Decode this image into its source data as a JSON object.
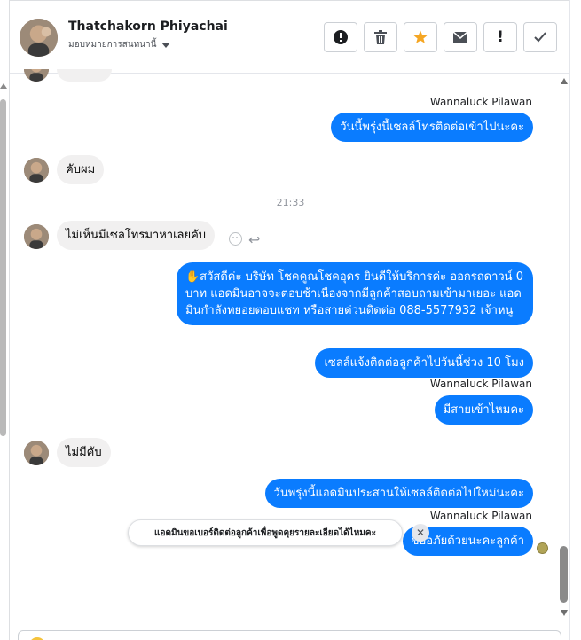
{
  "header": {
    "contact_name": "Thatchakorn Phiyachai",
    "contact_status": "มอบหมายการสนทนานี้",
    "actions": [
      {
        "name": "report-button",
        "glyph": "!",
        "icon": "alert-circle-icon"
      },
      {
        "name": "delete-button",
        "glyph": "🗑",
        "icon": "trash-icon"
      },
      {
        "name": "star-button",
        "glyph": "★",
        "icon": "star-icon"
      },
      {
        "name": "mark-unread-button",
        "glyph": "✉",
        "icon": "envelope-icon"
      },
      {
        "name": "spam-button",
        "glyph": "!",
        "icon": "exclamation-icon"
      },
      {
        "name": "done-button",
        "glyph": "✓",
        "icon": "check-icon"
      }
    ]
  },
  "messages": {
    "sender_1": "Wannaluck Pilawan",
    "out_1": "วันนี้พรุ่งนี้เซลล์โทรติดต่อเข้าไปนะคะ",
    "in_1": "คับผม",
    "time_1": "21:33",
    "in_2": "ไม่เห็นมีเซลโทรมาหาเลยคับ",
    "out_2": "✋สวัสดีค่ะ บริษัท โชคคูณโชคอุดร ยินดีให้บริการค่ะ ออกรถดาวน์ 0 บาท แอดมินอาจจะตอบช้าเนื่องจากมีลูกค้าสอบถามเข้ามาเยอะ แอดมินกำลังทยอยตอบแชท หรือสายด่วนติดต่อ 088-5577932 เจ้าหนู",
    "out_3": "เซลล์แจ้งติดต่อลูกค้าไปวันนี้ช่วง 10 โมง",
    "sender_2": "Wannaluck Pilawan",
    "out_4": "มีสายเข้าไหมคะ",
    "in_3": "ไม่มีคับ",
    "out_5": "วันพรุ่งนี้แอดมินประสานให้เซลล์ติดต่อไปใหม่นะคะ",
    "sender_3": "Wannaluck Pilawan",
    "out_6": "ขออภัยด้วยนะคะลูกค้า"
  },
  "suggestion": {
    "text": "แอดมินขอเบอร์ติดต่อลูกค้าเพื่อพูดคุยรายละเอียดได้ไหมคะ",
    "close_glyph": "✕"
  },
  "colors": {
    "outgoing_bubble": "#0a7cff",
    "incoming_bubble": "#f1f0f0",
    "star_accent": "#f5a623"
  }
}
